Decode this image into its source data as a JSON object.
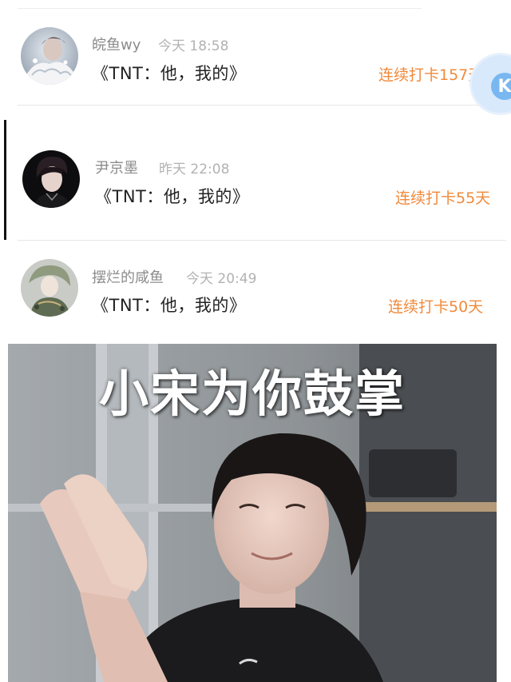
{
  "comments": [
    {
      "username": "皖鱼wy",
      "time": "今天 18:58",
      "message": "《TNT：他，我的》",
      "streak": "连续打卡157天",
      "avatar_icon": "avatar-girl-lace"
    },
    {
      "username": "尹京墨",
      "time": "昨天 22:08",
      "message": "《TNT：他，我的》",
      "streak": "连续打卡55天",
      "avatar_icon": "avatar-boy-portrait"
    },
    {
      "username": "摆烂的咸鱼",
      "time": "今天 20:49",
      "message": "《TNT：他，我的》",
      "streak": "连续打卡50天",
      "avatar_icon": "avatar-anime-character"
    }
  ],
  "float_button": {
    "icon": "k-logo-icon",
    "glyph": "K"
  },
  "meme": {
    "caption": "小宋为你鼓掌"
  },
  "colors": {
    "username": "#8c8c8c",
    "time": "#b2b2b2",
    "message": "#222222",
    "streak_orange": "#f08a3c"
  }
}
